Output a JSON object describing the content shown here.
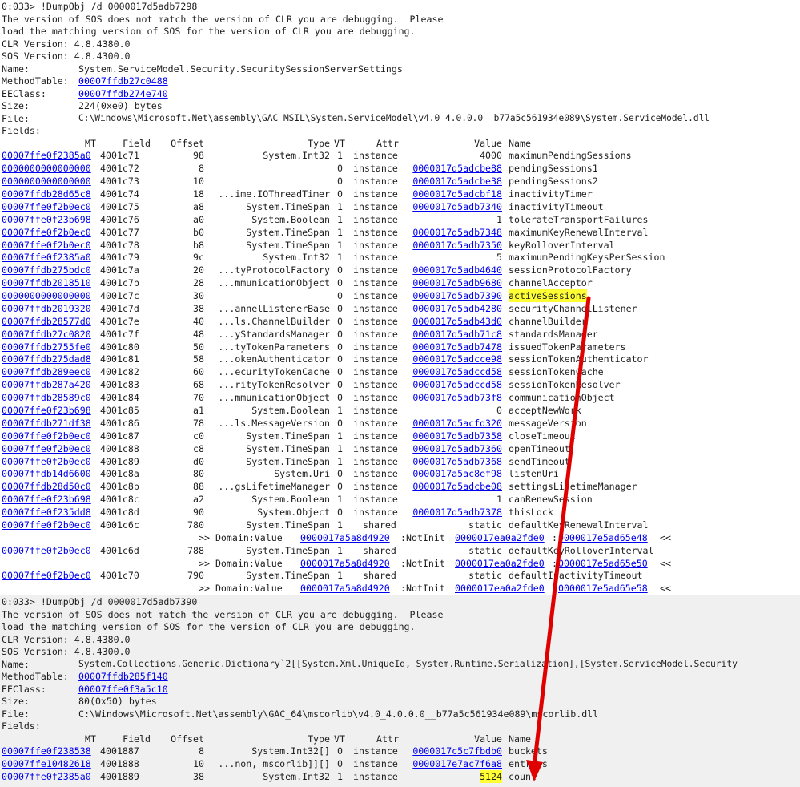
{
  "block1": {
    "prompt": "0:033> !DumpObj /d 0000017d5adb7298",
    "warn1": "The version of SOS does not match the version of CLR you are debugging.  Please",
    "warn2": "load the matching version of SOS for the version of CLR you are debugging.",
    "clr": "CLR Version: 4.8.4380.0",
    "sos": "SOS Version: 4.8.4300.0",
    "name_label": "Name:",
    "name_value": "System.ServiceModel.Security.SecuritySessionServerSettings",
    "mt_label": "MethodTable:",
    "mt_value": "00007ffdb27c0488",
    "ee_label": "EEClass:",
    "ee_value": "00007ffdb274e740",
    "size_label": "Size:",
    "size_value": "224(0xe0) bytes",
    "file_label": "File:",
    "file_value": "C:\\Windows\\Microsoft.Net\\assembly\\GAC_MSIL\\System.ServiceModel\\v4.0_4.0.0.0__b77a5c561934e089\\System.ServiceModel.dll",
    "fields_label": "Fields:",
    "header": {
      "mt": "MT",
      "field": "Field",
      "offset": "Offset",
      "type": "Type",
      "vt": "VT",
      "attr": "Attr",
      "value": "Value",
      "name": "Name"
    },
    "rows": [
      {
        "mt": "00007ffe0f2385a0",
        "field": "4001c71",
        "offset": "98",
        "type": "System.Int32",
        "vt": "1",
        "attr": "instance",
        "value": "4000",
        "name": "maximumPendingSessions"
      },
      {
        "mt": "0000000000000000",
        "field": "4001c72",
        "offset": "8",
        "type": "",
        "vt": "0",
        "attr": "instance",
        "value": "0000017d5adcbe88",
        "name": "pendingSessions1"
      },
      {
        "mt": "0000000000000000",
        "field": "4001c73",
        "offset": "10",
        "type": "",
        "vt": "0",
        "attr": "instance",
        "value": "0000017d5adcbe38",
        "name": "pendingSessions2"
      },
      {
        "mt": "00007ffdb28d65c8",
        "field": "4001c74",
        "offset": "18",
        "type": "...ime.IOThreadTimer",
        "vt": "0",
        "attr": "instance",
        "value": "0000017d5adcbf18",
        "name": "inactivityTimer"
      },
      {
        "mt": "00007ffe0f2b0ec0",
        "field": "4001c75",
        "offset": "a8",
        "type": "System.TimeSpan",
        "vt": "1",
        "attr": "instance",
        "value": "0000017d5adb7340",
        "name": "inactivityTimeout"
      },
      {
        "mt": "00007ffe0f23b698",
        "field": "4001c76",
        "offset": "a0",
        "type": "System.Boolean",
        "vt": "1",
        "attr": "instance",
        "value": "1",
        "name": "tolerateTransportFailures"
      },
      {
        "mt": "00007ffe0f2b0ec0",
        "field": "4001c77",
        "offset": "b0",
        "type": "System.TimeSpan",
        "vt": "1",
        "attr": "instance",
        "value": "0000017d5adb7348",
        "name": "maximumKeyRenewalInterval"
      },
      {
        "mt": "00007ffe0f2b0ec0",
        "field": "4001c78",
        "offset": "b8",
        "type": "System.TimeSpan",
        "vt": "1",
        "attr": "instance",
        "value": "0000017d5adb7350",
        "name": "keyRolloverInterval"
      },
      {
        "mt": "00007ffe0f2385a0",
        "field": "4001c79",
        "offset": "9c",
        "type": "System.Int32",
        "vt": "1",
        "attr": "instance",
        "value": "5",
        "name": "maximumPendingKeysPerSession"
      },
      {
        "mt": "00007ffdb275bdc0",
        "field": "4001c7a",
        "offset": "20",
        "type": "...tyProtocolFactory",
        "vt": "0",
        "attr": "instance",
        "value": "0000017d5adb4640",
        "name": "sessionProtocolFactory"
      },
      {
        "mt": "00007ffdb2018510",
        "field": "4001c7b",
        "offset": "28",
        "type": "...mmunicationObject",
        "vt": "0",
        "attr": "instance",
        "value": "0000017d5adb9680",
        "name": "channelAcceptor"
      },
      {
        "mt": "0000000000000000",
        "field": "4001c7c",
        "offset": "30",
        "type": "",
        "vt": "0",
        "attr": "instance",
        "value": "0000017d5adb7390",
        "name": "activeSessions"
      },
      {
        "mt": "00007ffdb2019320",
        "field": "4001c7d",
        "offset": "38",
        "type": "...annelListenerBase",
        "vt": "0",
        "attr": "instance",
        "value": "0000017d5adb4280",
        "name": "securityChannelListener"
      },
      {
        "mt": "00007ffdb28577d0",
        "field": "4001c7e",
        "offset": "40",
        "type": "...ls.ChannelBuilder",
        "vt": "0",
        "attr": "instance",
        "value": "0000017d5adb43d0",
        "name": "channelBuilder"
      },
      {
        "mt": "00007ffdb27c0820",
        "field": "4001c7f",
        "offset": "48",
        "type": "...yStandardsManager",
        "vt": "0",
        "attr": "instance",
        "value": "0000017d5adb71c8",
        "name": "standardsManager"
      },
      {
        "mt": "00007ffdb2755fe0",
        "field": "4001c80",
        "offset": "50",
        "type": "...tyTokenParameters",
        "vt": "0",
        "attr": "instance",
        "value": "0000017d5adb7478",
        "name": "issuedTokenParameters"
      },
      {
        "mt": "00007ffdb275dad8",
        "field": "4001c81",
        "offset": "58",
        "type": "...okenAuthenticator",
        "vt": "0",
        "attr": "instance",
        "value": "0000017d5adcce98",
        "name": "sessionTokenAuthenticator"
      },
      {
        "mt": "00007ffdb289eec0",
        "field": "4001c82",
        "offset": "60",
        "type": "...ecurityTokenCache",
        "vt": "0",
        "attr": "instance",
        "value": "0000017d5adccd58",
        "name": "sessionTokenCache"
      },
      {
        "mt": "00007ffdb287a420",
        "field": "4001c83",
        "offset": "68",
        "type": "...rityTokenResolver",
        "vt": "0",
        "attr": "instance",
        "value": "0000017d5adccd58",
        "name": "sessionTokenResolver"
      },
      {
        "mt": "00007ffdb28589c0",
        "field": "4001c84",
        "offset": "70",
        "type": "...mmunicationObject",
        "vt": "0",
        "attr": "instance",
        "value": "0000017d5adb73f8",
        "name": "communicationObject"
      },
      {
        "mt": "00007ffe0f23b698",
        "field": "4001c85",
        "offset": "a1",
        "type": "System.Boolean",
        "vt": "1",
        "attr": "instance",
        "value": "0",
        "name": "acceptNewWork"
      },
      {
        "mt": "00007ffdb271df38",
        "field": "4001c86",
        "offset": "78",
        "type": "...ls.MessageVersion",
        "vt": "0",
        "attr": "instance",
        "value": "0000017d5acfd320",
        "name": "messageVersion"
      },
      {
        "mt": "00007ffe0f2b0ec0",
        "field": "4001c87",
        "offset": "c0",
        "type": "System.TimeSpan",
        "vt": "1",
        "attr": "instance",
        "value": "0000017d5adb7358",
        "name": "closeTimeout"
      },
      {
        "mt": "00007ffe0f2b0ec0",
        "field": "4001c88",
        "offset": "c8",
        "type": "System.TimeSpan",
        "vt": "1",
        "attr": "instance",
        "value": "0000017d5adb7360",
        "name": "openTimeout"
      },
      {
        "mt": "00007ffe0f2b0ec0",
        "field": "4001c89",
        "offset": "d0",
        "type": "System.TimeSpan",
        "vt": "1",
        "attr": "instance",
        "value": "0000017d5adb7368",
        "name": "sendTimeout"
      },
      {
        "mt": "00007ffdb14d6600",
        "field": "4001c8a",
        "offset": "80",
        "type": "System.Uri",
        "vt": "0",
        "attr": "instance",
        "value": "0000017a5ac8ef98",
        "name": "listenUri"
      },
      {
        "mt": "00007ffdb28d50c0",
        "field": "4001c8b",
        "offset": "88",
        "type": "...gsLifetimeManager",
        "vt": "0",
        "attr": "instance",
        "value": "0000017d5adcbe08",
        "name": "settingsLifetimeManager"
      },
      {
        "mt": "00007ffe0f23b698",
        "field": "4001c8c",
        "offset": "a2",
        "type": "System.Boolean",
        "vt": "1",
        "attr": "instance",
        "value": "1",
        "name": "canRenewSession"
      },
      {
        "mt": "00007ffe0f235dd8",
        "field": "4001c8d",
        "offset": "90",
        "type": "System.Object",
        "vt": "0",
        "attr": "instance",
        "value": "0000017d5adb7378",
        "name": "thisLock"
      }
    ],
    "static_rows": [
      {
        "mt": "00007ffe0f2b0ec0",
        "field": "4001c6c",
        "offset": "780",
        "type": "System.TimeSpan",
        "vt": "1",
        "attr": "shared",
        "value": "static",
        "name": "defaultKeyRenewalInterval",
        "domain_label": ">> Domain:Value",
        "d1": "0000017a5a8d4920",
        "d1s": ":NotInit",
        "d2": "0000017ea0a2fde0",
        "sep": ":",
        "d3": "0000017e5ad65e48",
        "end": " <<"
      },
      {
        "mt": "00007ffe0f2b0ec0",
        "field": "4001c6d",
        "offset": "788",
        "type": "System.TimeSpan",
        "vt": "1",
        "attr": "shared",
        "value": "static",
        "name": "defaultKeyRolloverInterval",
        "domain_label": ">> Domain:Value",
        "d1": "0000017a5a8d4920",
        "d1s": ":NotInit",
        "d2": "0000017ea0a2fde0",
        "sep": ":",
        "d3": "0000017e5ad65e50",
        "end": " <<"
      },
      {
        "mt": "00007ffe0f2b0ec0",
        "field": "4001c70",
        "offset": "790",
        "type": "System.TimeSpan",
        "vt": "1",
        "attr": "shared",
        "value": "static",
        "name": "defaultInactivityTimeout",
        "domain_label": ">> Domain:Value",
        "d1": "0000017a5a8d4920",
        "d1s": ":NotInit",
        "d2": "0000017ea0a2fde0",
        "sep": ":",
        "d3": "0000017e5ad65e58",
        "end": " <<"
      }
    ]
  },
  "block2": {
    "prompt": "0:033> !DumpObj /d 0000017d5adb7390",
    "warn1": "The version of SOS does not match the version of CLR you are debugging.  Please",
    "warn2": "load the matching version of SOS for the version of CLR you are debugging.",
    "clr": "CLR Version: 4.8.4380.0",
    "sos": "SOS Version: 4.8.4300.0",
    "name_label": "Name:",
    "name_value": "System.Collections.Generic.Dictionary`2[[System.Xml.UniqueId, System.Runtime.Serialization],[System.ServiceModel.Security",
    "mt_label": "MethodTable:",
    "mt_value": "00007ffdb285f140",
    "ee_label": "EEClass:",
    "ee_value": "00007ffe0f3a5c10",
    "size_label": "Size:",
    "size_value": "80(0x50) bytes",
    "file_label": "File:",
    "file_value": "C:\\Windows\\Microsoft.Net\\assembly\\GAC_64\\mscorlib\\v4.0_4.0.0.0__b77a5c561934e089\\mscorlib.dll",
    "fields_label": "Fields:",
    "header": {
      "mt": "MT",
      "field": "Field",
      "offset": "Offset",
      "type": "Type",
      "vt": "VT",
      "attr": "Attr",
      "value": "Value",
      "name": "Name"
    },
    "rows": [
      {
        "mt": "00007ffe0f238538",
        "field": "4001887",
        "offset": "8",
        "type": "System.Int32[]",
        "vt": "0",
        "attr": "instance",
        "value": "0000017c5c7fbdb0",
        "name": "buckets"
      },
      {
        "mt": "00007ffe10482618",
        "field": "4001888",
        "offset": "10",
        "type": "...non, mscorlib]][]",
        "vt": "0",
        "attr": "instance",
        "value": "0000017e7ac7f6a8",
        "name": "entries"
      },
      {
        "mt": "00007ffe0f2385a0",
        "field": "4001889",
        "offset": "38",
        "type": "System.Int32",
        "vt": "1",
        "attr": "instance",
        "value": "5124",
        "name": "count"
      }
    ]
  },
  "highlight_names": [
    "activeSessions"
  ],
  "highlight_values": [
    "5124"
  ],
  "colors": {
    "link": "#0000ee",
    "highlight": "#ffff33",
    "arrow": "#e00000",
    "block2_bg": "#f0f0f0",
    "text": "#1e1e1e"
  }
}
